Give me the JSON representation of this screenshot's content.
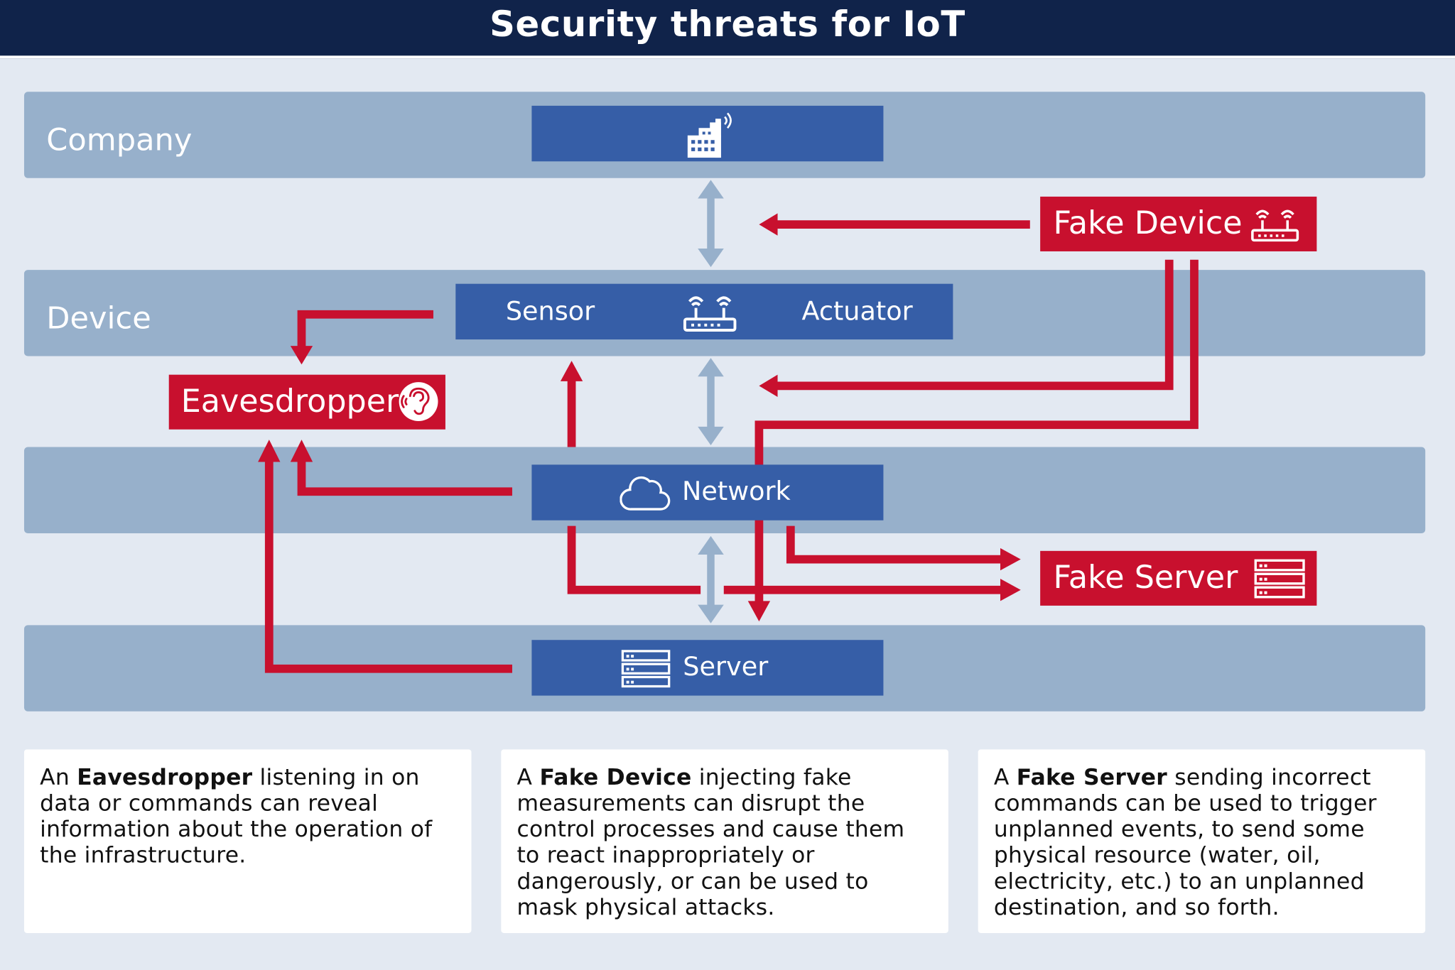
{
  "title": "Security threats for IoT",
  "layers": {
    "company": "Company",
    "device": "Device"
  },
  "nodes": {
    "sensor": "Sensor",
    "actuator": "Actuator",
    "network": "Network",
    "server": "Server"
  },
  "threats": {
    "fake_device": "Fake Device",
    "eavesdropper": "Eavesdropper",
    "fake_server": "Fake Server"
  },
  "notes": [
    {
      "pre": "An ",
      "bold": "Eavesdropper",
      "post": " listening in on data or commands can reveal information about the operation of the infrastructure."
    },
    {
      "pre": "A ",
      "bold": "Fake Device",
      "post": " injecting fake measurements can disrupt the control processes and cause them to react inappropriately or dangerously, or can be used to mask physical attacks."
    },
    {
      "pre": "A ",
      "bold": "Fake Server",
      "post": " sending incorrect commands can be used to trigger unplanned events, to send some physical resource (water, oil, electricity, etc.) to an unplanned destination, and so forth."
    }
  ],
  "colors": {
    "title_bg": "#10234a",
    "band": "#97b0cb",
    "node": "#365ea7",
    "threat": "#c8102e",
    "connector": "#97b0cb"
  }
}
